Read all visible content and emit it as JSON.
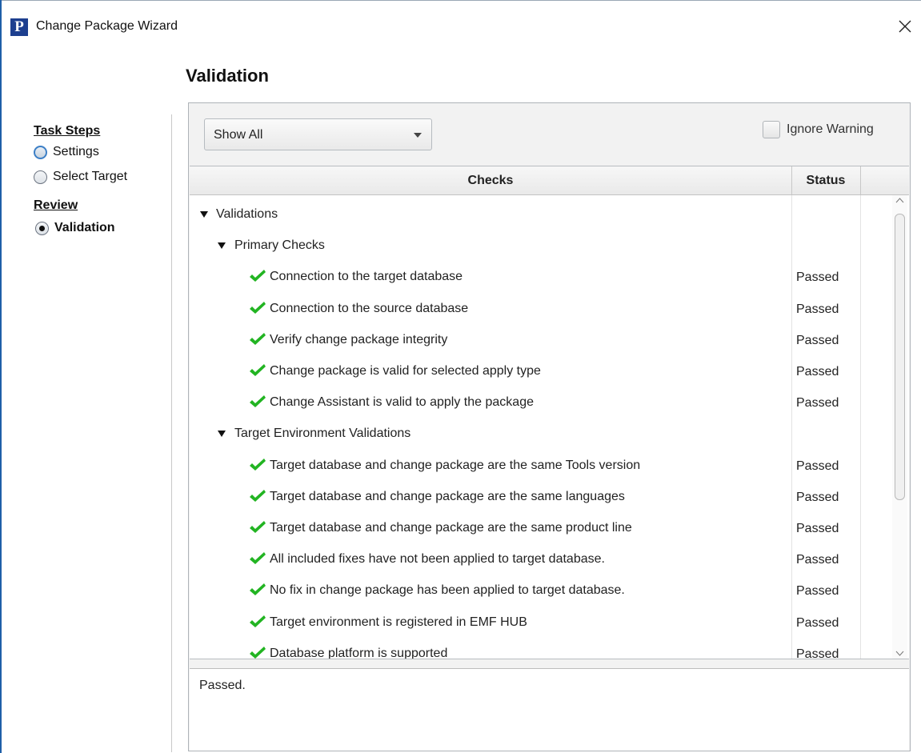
{
  "window": {
    "title": "Change Package Wizard",
    "logo_letter": "P"
  },
  "page": {
    "title": "Validation"
  },
  "sidebar": {
    "task_steps_heading": "Task Steps",
    "task_steps": [
      {
        "label": "Settings",
        "state": "focused"
      },
      {
        "label": "Select Target",
        "state": "unchecked"
      }
    ],
    "review_heading": "Review",
    "review_steps": [
      {
        "label": "Validation",
        "state": "checked"
      }
    ]
  },
  "filter": {
    "selected": "Show All"
  },
  "ignore_warning": {
    "label": "Ignore Warning",
    "checked": false
  },
  "table": {
    "columns": {
      "checks": "Checks",
      "status": "Status"
    },
    "rows": [
      {
        "level": 0,
        "type": "group",
        "text": "Validations",
        "status": ""
      },
      {
        "level": 1,
        "type": "group",
        "text": "Primary Checks",
        "status": ""
      },
      {
        "level": 2,
        "type": "check",
        "text": "Connection to the target database",
        "status": "Passed"
      },
      {
        "level": 2,
        "type": "check",
        "text": "Connection to the source database",
        "status": "Passed"
      },
      {
        "level": 2,
        "type": "check",
        "text": "Verify change package integrity",
        "status": "Passed"
      },
      {
        "level": 2,
        "type": "check",
        "text": "Change package is valid for selected apply type",
        "status": "Passed"
      },
      {
        "level": 2,
        "type": "check",
        "text": "Change Assistant is valid to apply the package",
        "status": "Passed"
      },
      {
        "level": 1,
        "type": "group",
        "text": "Target Environment Validations",
        "status": ""
      },
      {
        "level": 2,
        "type": "check",
        "text": "Target database and change package are the same Tools version",
        "status": "Passed"
      },
      {
        "level": 2,
        "type": "check",
        "text": "Target database and change package are the same languages",
        "status": "Passed"
      },
      {
        "level": 2,
        "type": "check",
        "text": "Target database and change package are the same product line",
        "status": "Passed"
      },
      {
        "level": 2,
        "type": "check",
        "text": "All included fixes have not been applied to target database.",
        "status": "Passed"
      },
      {
        "level": 2,
        "type": "check",
        "text": "No fix in change package has been applied to target database.",
        "status": "Passed"
      },
      {
        "level": 2,
        "type": "check",
        "text": "Target environment is registered in EMF HUB",
        "status": "Passed"
      },
      {
        "level": 2,
        "type": "check",
        "text": "Database platform is supported",
        "status": "Passed"
      }
    ]
  },
  "message": "Passed.",
  "colors": {
    "check": "#22b422",
    "accent": "#1f5fa8",
    "logo": "#1d3f8f"
  }
}
